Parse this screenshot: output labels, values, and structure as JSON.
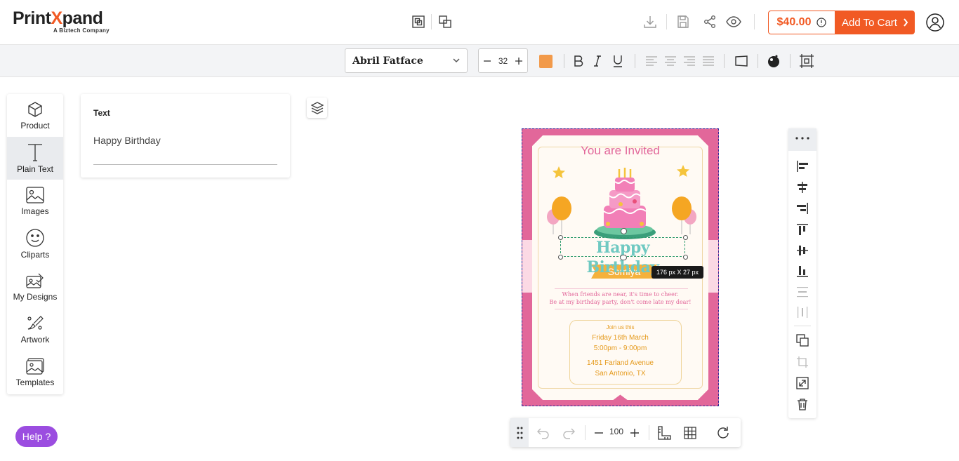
{
  "brand": {
    "name_a": "Print",
    "name_x": "X",
    "name_b": "pand",
    "tagline": "A Biztech Company",
    "accent": "#f15a24"
  },
  "header": {
    "price": "$40.00",
    "add_to_cart": "Add To Cart"
  },
  "toolbar": {
    "font_name": "Abril Fatface",
    "font_size": "32",
    "text_color": "#f29a4a"
  },
  "sidebar": {
    "items": [
      {
        "label": "Product",
        "icon": "cube-icon"
      },
      {
        "label": "Plain Text",
        "icon": "text-icon"
      },
      {
        "label": "Images",
        "icon": "image-icon"
      },
      {
        "label": "Cliparts",
        "icon": "smiley-icon"
      },
      {
        "label": "My Designs",
        "icon": "designs-icon"
      },
      {
        "label": "Artwork",
        "icon": "artwork-icon"
      },
      {
        "label": "Templates",
        "icon": "templates-icon"
      }
    ]
  },
  "text_panel": {
    "title": "Text",
    "value": "Happy Birthday"
  },
  "card": {
    "title": "You are Invited",
    "headline": "Happy Birthday",
    "name": "Somiya",
    "message_1": "When friends are near, it's time to cheer.",
    "message_2": "Be at my birthday party, don't come late my dear!",
    "join": "Join us this",
    "date": "Friday 16th March",
    "time": "5:00pm - 9:00pm",
    "address_1": "1451 Farland Avenue",
    "address_2": "San Antonio, TX"
  },
  "selection": {
    "size_label": "176 px X 27 px"
  },
  "bottom": {
    "zoom": "100"
  },
  "help": {
    "label": "Help ?"
  }
}
